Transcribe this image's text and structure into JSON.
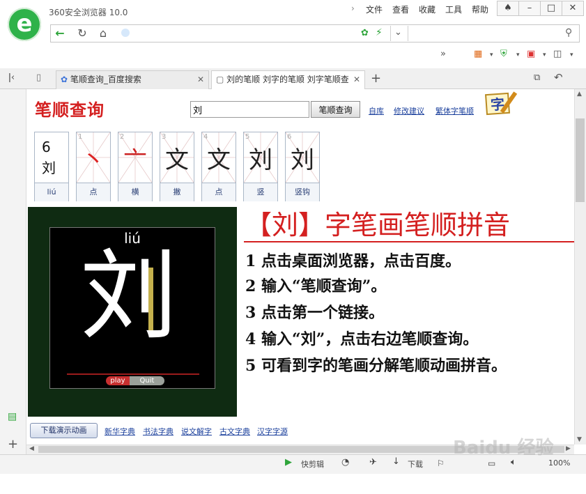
{
  "window": {
    "title": "360安全浏览器 10.0",
    "menus": [
      "文件",
      "查看",
      "收藏",
      "工具",
      "帮助"
    ]
  },
  "address": {
    "value": "",
    "search_value": ""
  },
  "tabs": [
    {
      "label": "笔顺查询_百度搜索"
    },
    {
      "label": "刘的笔顺 刘字的笔顺 刘字笔顺查"
    }
  ],
  "site": {
    "title": "笔顺查询",
    "query_value": "刘",
    "query_button": "笔顺查询",
    "links": [
      "自库",
      "修改建议",
      "繁体字笔顺"
    ],
    "logo_char": "字"
  },
  "stroke_cards": [
    {
      "num": "",
      "glyph": "6\n刘",
      "label": "liú"
    },
    {
      "num": "1",
      "glyph": "丶",
      "label": "点"
    },
    {
      "num": "2",
      "glyph": "亠",
      "label": "横"
    },
    {
      "num": "3",
      "glyph": "文",
      "label": "撇"
    },
    {
      "num": "4",
      "glyph": "文",
      "label": "点"
    },
    {
      "num": "5",
      "glyph": "刘",
      "label": "竖"
    },
    {
      "num": "6",
      "glyph": "刘",
      "label": "竖钩"
    }
  ],
  "animation": {
    "pinyin": "liú",
    "character": "刘",
    "play": "play",
    "quit": "Quit"
  },
  "instructions": {
    "headline": "【刘】字笔画笔顺拼音",
    "steps": [
      "1 点击桌面浏览器，点击百度。",
      "2 输入“笔顺查询”。",
      "3 点击第一个链接。",
      "4 输入“刘”，点击右边笔顺查询。",
      "5 可看到字的笔画分解笔顺动画拼音。"
    ]
  },
  "bottom": {
    "download": "下载演示动画",
    "links": [
      "新华字典",
      "书法字典",
      "说文解字",
      "古文字典",
      "汉字字源"
    ]
  },
  "status": {
    "quick_edit": "快剪辑",
    "download": "下载",
    "zoom": "100%"
  }
}
